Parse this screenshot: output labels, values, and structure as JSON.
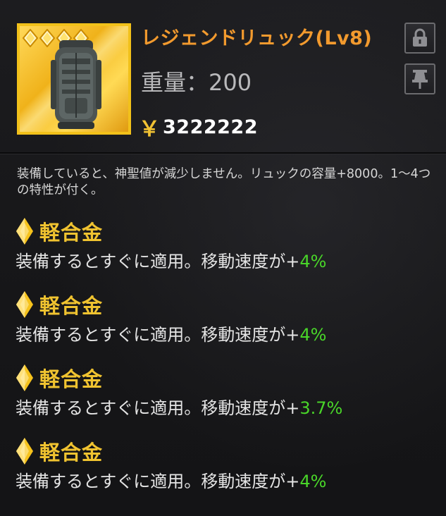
{
  "item": {
    "title": "レジェンドリュック(Lv8)",
    "weight_text": "重量：200",
    "weight_ghost_text": "",
    "currency_symbol": "￥",
    "price": "3222222",
    "star_count": 4,
    "icon": "backpack-icon",
    "frame_color": "#f2c11a"
  },
  "buttons": {
    "lock_icon": "lock-icon",
    "pin_icon": "pin-icon"
  },
  "description": "装備していると、神聖値が減少しません。リュックの容量+8000。1～4つの特性が付く。",
  "traits": [
    {
      "name": "軽合金",
      "text": "装備するとすぐに適用。移動速度が+",
      "value": "4%"
    },
    {
      "name": "軽合金",
      "text": "装備するとすぐに適用。移動速度が+",
      "value": "4%"
    },
    {
      "name": "軽合金",
      "text": "装備するとすぐに適用。移動速度が+",
      "value": "3.7%"
    },
    {
      "name": "軽合金",
      "text": "装備するとすぐに適用。移動速度が+",
      "value": "4%"
    }
  ],
  "colors": {
    "title": "#f29a2e",
    "trait_name": "#f0c330",
    "trait_value": "#49d629",
    "currency": "#f1c233"
  }
}
